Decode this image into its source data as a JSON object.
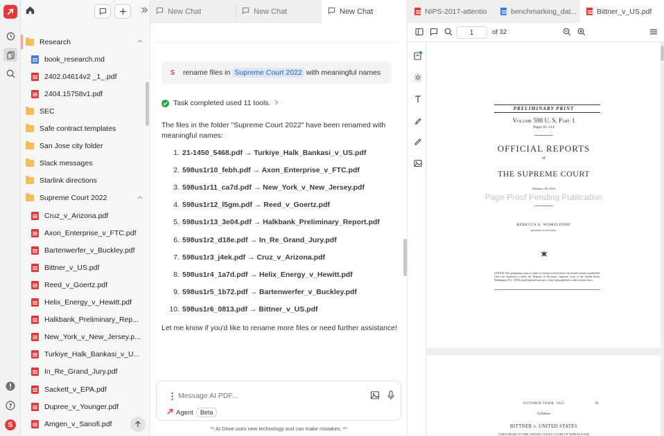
{
  "sidebar": {
    "items": [
      {
        "label": "Research",
        "type": "folder",
        "level": 0,
        "open": true
      },
      {
        "label": "book_research.md",
        "type": "md",
        "level": 1
      },
      {
        "label": "2402.04614v2 _1_.pdf",
        "type": "pdf",
        "level": 1
      },
      {
        "label": "2404.15758v1.pdf",
        "type": "pdf",
        "level": 1
      },
      {
        "label": "SEC",
        "type": "folder",
        "level": 0
      },
      {
        "label": "Safe contract templates",
        "type": "folder",
        "level": 0
      },
      {
        "label": "San Jose city folder",
        "type": "folder",
        "level": 0
      },
      {
        "label": "Slack messages",
        "type": "folder",
        "level": 0
      },
      {
        "label": "Starlink directions",
        "type": "folder",
        "level": 0
      },
      {
        "label": "Supreme Court 2022",
        "type": "folder",
        "level": 0,
        "open": true
      },
      {
        "label": "Cruz_v_Arizona.pdf",
        "type": "pdf",
        "level": 1
      },
      {
        "label": "Axon_Enterprise_v_FTC.pdf",
        "type": "pdf",
        "level": 1
      },
      {
        "label": "Bartenwerfer_v_Buckley.pdf",
        "type": "pdf",
        "level": 1
      },
      {
        "label": "Bittner_v_US.pdf",
        "type": "pdf",
        "level": 1
      },
      {
        "label": "Reed_v_Goertz.pdf",
        "type": "pdf",
        "level": 1
      },
      {
        "label": "Helix_Energy_v_Hewitt.pdf",
        "type": "pdf",
        "level": 1
      },
      {
        "label": "Halkbank_Preliminary_Rep...",
        "type": "pdf",
        "level": 1
      },
      {
        "label": "New_York_v_New_Jersey.p...",
        "type": "pdf",
        "level": 1
      },
      {
        "label": "Turkiye_Halk_Bankasi_v_U...",
        "type": "pdf",
        "level": 1
      },
      {
        "label": "In_Re_Grand_Jury.pdf",
        "type": "pdf",
        "level": 1
      },
      {
        "label": "Sackett_v_EPA.pdf",
        "type": "pdf",
        "level": 1
      },
      {
        "label": "Dupree_v_Younger.pdf",
        "type": "pdf",
        "level": 1
      },
      {
        "label": "Amgen_v_Sanofi.pdf",
        "type": "pdf",
        "level": 1
      }
    ]
  },
  "rail": {
    "avatar_letter": "S"
  },
  "tabs": [
    {
      "label": "New Chat",
      "active": false
    },
    {
      "label": "New Chat",
      "active": false
    },
    {
      "label": "New Chat",
      "active": true
    }
  ],
  "chat": {
    "user_avatar": "S",
    "user_msg_prefix": "rename files in",
    "user_msg_tag": "Supreme Court 2022",
    "user_msg_suffix": "with meaningful names",
    "task_status": "Task completed used 11 tools.",
    "intro": "The files in the folder \"Supreme Court 2022\" have been renamed with meaningful names:",
    "renames": [
      "21-1450_5468.pdf → Turkiye_Halk_Bankasi_v_US.pdf",
      "598us1r10_febh.pdf → Axon_Enterprise_v_FTC.pdf",
      "598us1r11_ca7d.pdf → New_York_v_New_Jersey.pdf",
      "598us1r12_l5gm.pdf → Reed_v_Goertz.pdf",
      "598us1r13_3e04.pdf → Halkbank_Preliminary_Report.pdf",
      "598us1r2_d18e.pdf → In_Re_Grand_Jury.pdf",
      "598us1r3_j4ek.pdf → Cruz_v_Arizona.pdf",
      "598us1r4_1a7d.pdf → Helix_Energy_v_Hewitt.pdf",
      "598us1r5_1b72.pdf → Bartenwerfer_v_Buckley.pdf",
      "598us1r6_0813.pdf → Bittner_v_US.pdf"
    ],
    "closing": "Let me know if you'd like to rename more files or need further assistance!",
    "input_placeholder": "Message AI PDF...",
    "agent_label": "Agent",
    "beta_label": "Beta",
    "disclaimer": "** AI Drive uses new technology and can make mistakes. **"
  },
  "pdf_tabs": [
    {
      "label": "NIPS-2017-attentio",
      "active": false
    },
    {
      "label": "benchmarking_dat...",
      "active": false
    },
    {
      "label": "Bittner_v_US.pdf",
      "active": true
    }
  ],
  "pdf_toolbar": {
    "page": "1",
    "page_count": "of 32"
  },
  "pdf_page1": {
    "header": "PRELIMINARY PRINT",
    "volume": "Volume 598 U. S. Part 1",
    "pages": "Pages 85–114",
    "title1": "OFFICIAL REPORTS",
    "of": "of",
    "title2": "THE SUPREME COURT",
    "date": "February 28, 2023",
    "watermark": "Page Proof Pending Publication",
    "reporter": "REBECCA A. WOMELDORF",
    "reporter_title": "reporter of decisions",
    "notice": "NOTICE: This preliminary print is subject to formal revision before the bound volume is published. Users are requested to notify the Reporter of Decisions, Supreme Court of the United States, Washington, D.C. 20543, pio@supremecourt.gov, of any typographical or other formal errors."
  },
  "pdf_page2": {
    "term": "OCTOBER TERM, 2022",
    "page_no": "85",
    "syllabus": "Syllabus",
    "case": "BITTNER v. UNITED STATES",
    "cert": "CERTIORARI TO THE UNITED STATES COURT OF APPEALS FOR"
  },
  "colors": {
    "brand": "#e5383b",
    "folder": "#f4bd55",
    "md": "#3c7bd9",
    "success": "#28a745",
    "tag_bg": "#dbe8fb"
  }
}
